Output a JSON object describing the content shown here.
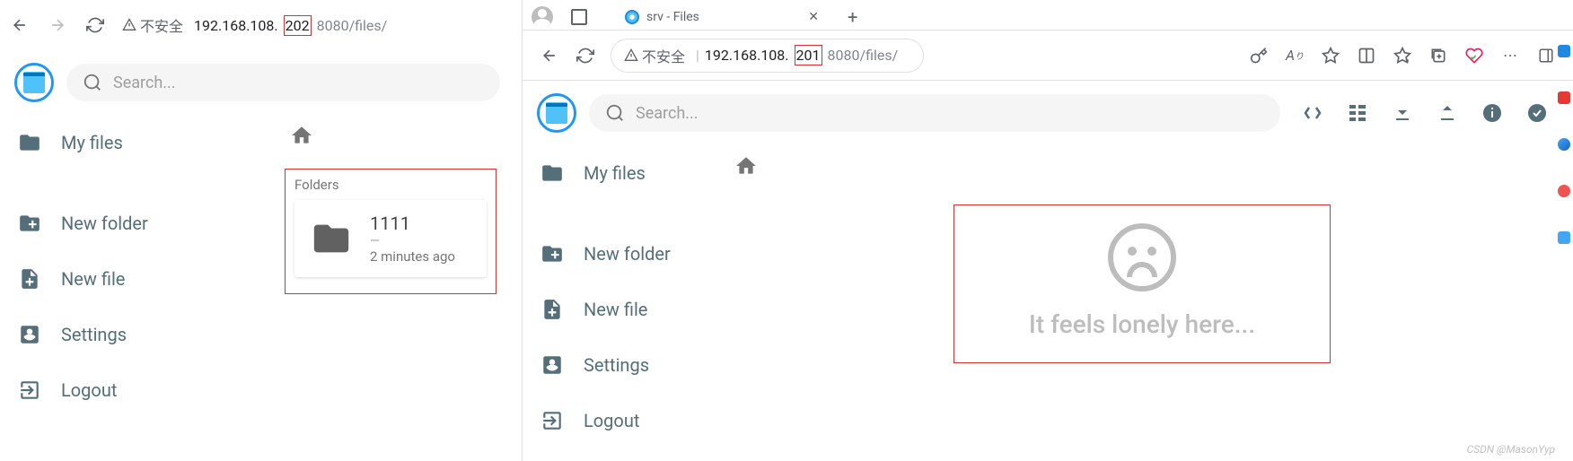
{
  "left": {
    "url_prefix": "192.168.108.",
    "url_highlight": "202",
    "url_suffix": "8080/files/",
    "insecure_label": "不安全",
    "search_placeholder": "Search...",
    "sidebar": {
      "my_files": "My files",
      "new_folder": "New folder",
      "new_file": "New file",
      "settings": "Settings",
      "logout": "Logout"
    },
    "folders_label": "Folders",
    "folder": {
      "name": "1111",
      "size": "—",
      "time": "2 minutes ago"
    }
  },
  "right": {
    "tab_title": "srv - Files",
    "url_prefix": "192.168.108.",
    "url_highlight": "201",
    "url_suffix": "8080/files/",
    "insecure_label": "不安全",
    "search_placeholder": "Search...",
    "sidebar": {
      "my_files": "My files",
      "new_folder": "New folder",
      "new_file": "New file",
      "settings": "Settings",
      "logout": "Logout"
    },
    "empty_text": "It feels lonely here..."
  },
  "watermark": "CSDN @MasonYyp"
}
